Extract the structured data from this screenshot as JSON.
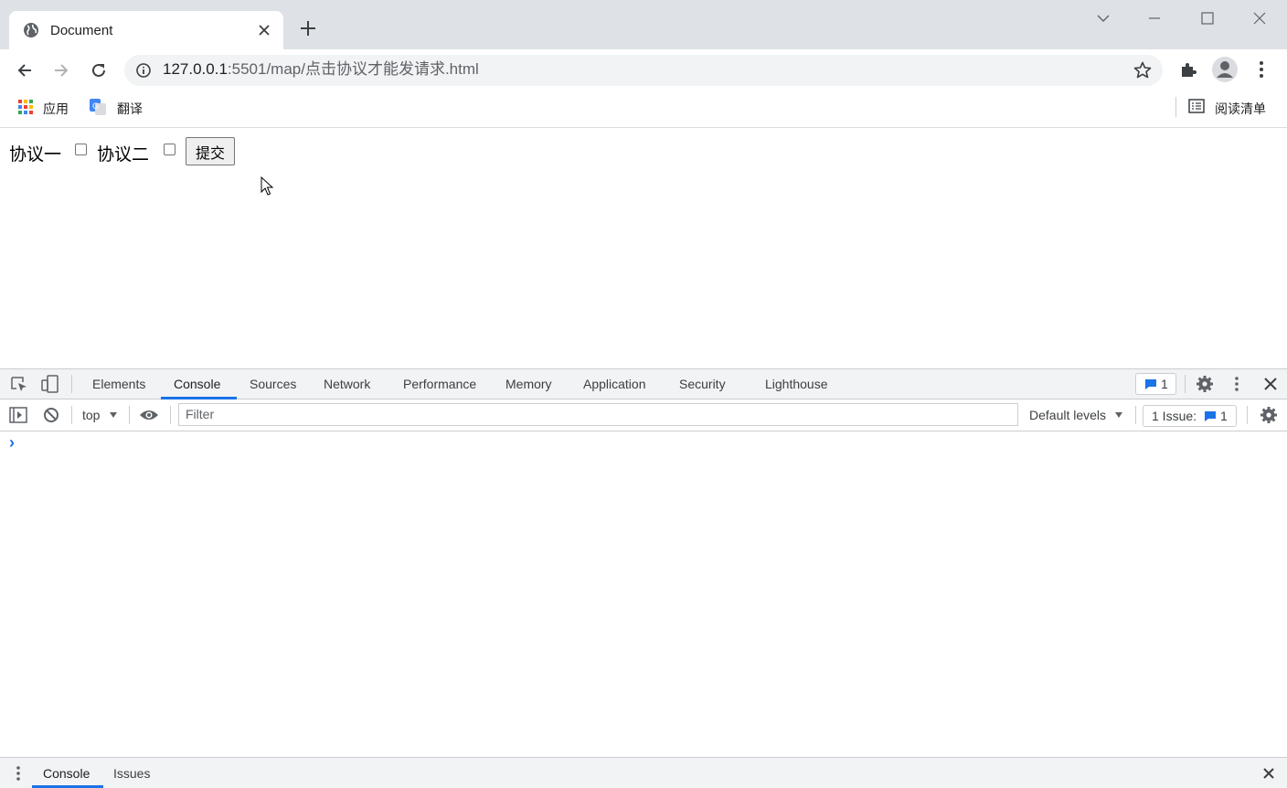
{
  "browser": {
    "tab_title": "Document",
    "url_host": "127.0.0.1",
    "url_rest": ":5501/map/点击协议才能发请求.html"
  },
  "bookmarks": {
    "apps_label": "应用",
    "translate_label": "翻译",
    "reading_list_label": "阅读清单"
  },
  "page": {
    "agreement1_label": "协议一",
    "agreement2_label": "协议二",
    "submit_label": "提交"
  },
  "devtools": {
    "tabs": [
      "Elements",
      "Console",
      "Sources",
      "Network",
      "Performance",
      "Memory",
      "Application",
      "Security",
      "Lighthouse"
    ],
    "active_tab": "Console",
    "messages_badge": "1",
    "context": "top",
    "filter_placeholder": "Filter",
    "levels": "Default levels",
    "issues_label": "1 Issue:",
    "issues_count": "1",
    "prompt": "›",
    "drawer_tabs": [
      "Console",
      "Issues"
    ]
  },
  "colors": {
    "accent": "#1a73e8",
    "tabstrip": "#dee1e6",
    "devtools_bar": "#f1f3f4"
  }
}
